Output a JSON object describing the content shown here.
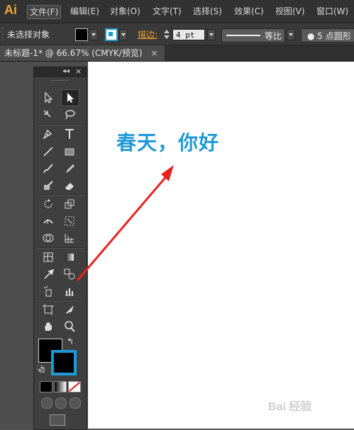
{
  "app": {
    "logo": "Ai"
  },
  "menu": [
    {
      "label": "文件(F)",
      "active": true
    },
    {
      "label": "编辑(E)"
    },
    {
      "label": "对象(O)"
    },
    {
      "label": "文字(T)"
    },
    {
      "label": "选择(S)"
    },
    {
      "label": "效果(C)"
    },
    {
      "label": "视图(V)"
    },
    {
      "label": "窗口(W)"
    }
  ],
  "control": {
    "selection_label": "未选择对象",
    "stroke_label": "描边:",
    "stroke_weight": "4 pt",
    "style_label": "等比",
    "brush_label": "● 5 点圆形"
  },
  "document": {
    "tab_title": "未标题-1* @ 66.67% (CMYK/预览)",
    "close_glyph": "×"
  },
  "artboard": {
    "text": "春天，你好",
    "text_color": "#1e9ad6"
  },
  "toolpanel": {
    "collapse_glyph": "◂◂",
    "close_glyph": "×",
    "swap_glyph": "↰"
  },
  "watermark": {
    "text": "Bai 经验"
  },
  "colors": {
    "accent": "#1e9ad6",
    "arrow": "#e8231e",
    "stroke_label": "#f0a030"
  }
}
